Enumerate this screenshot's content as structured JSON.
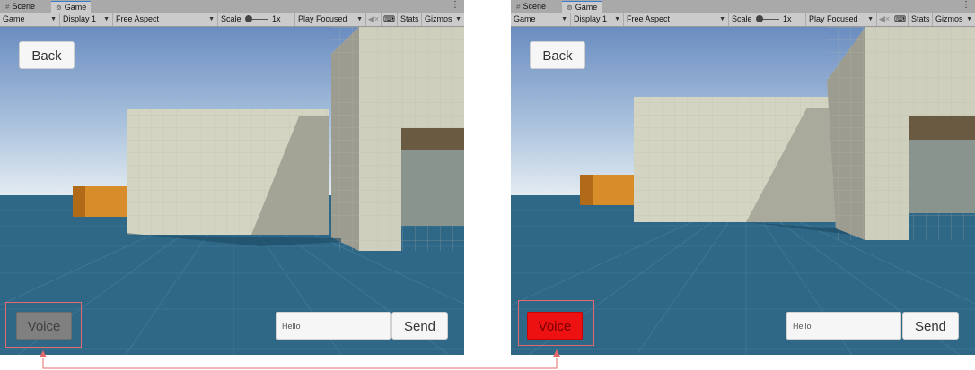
{
  "tabs": {
    "scene_label": "Scene",
    "game_label": "Game"
  },
  "toolbar": {
    "game_select": "Game",
    "display_select": "Display 1",
    "aspect_select": "Free Aspect",
    "scale_label": "Scale",
    "scale_value": "1x",
    "play_mode_select": "Play Focused",
    "stats_label": "Stats",
    "gizmos_label": "Gizmos"
  },
  "ui": {
    "back_label": "Back",
    "voice_label": "Voice",
    "message_value": "Hello",
    "send_label": "Send"
  },
  "states": {
    "left": {
      "voice_active": false,
      "voice_color": "#808080"
    },
    "right": {
      "voice_active": true,
      "voice_color": "#ee1111"
    }
  },
  "colors": {
    "annotation": "#e26a6a",
    "ground": "#2f6787",
    "sky_top": "#6a8cc0",
    "sky_horizon": "#dce6f0",
    "wall": "#d0d0c0",
    "crate": "#d98c2a"
  },
  "icons": {
    "scene_tab": "grid-icon",
    "game_tab": "gamepad-icon",
    "menu": "kebab-menu-icon",
    "mute": "speaker-muted-icon",
    "stats": "keyboard-icon"
  }
}
